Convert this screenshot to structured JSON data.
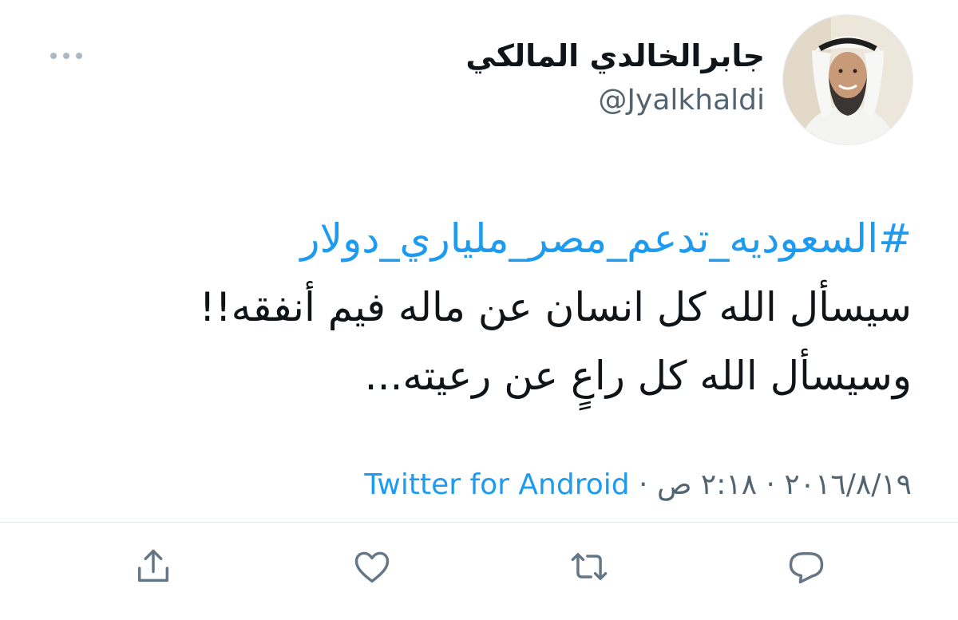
{
  "author": {
    "display_name": "جابرالخالدي المالكي",
    "handle": "@Jyalkhaldi",
    "avatar_icon": "user-avatar"
  },
  "tweet": {
    "hashtag": "#السعوديه_تدعم_مصر_ملياري_دولار",
    "lines": [
      "سيسأل الله كل انسان عن ماله فيم أنفقه!!",
      "وسيسأل الله كل راعٍ عن رعيته..."
    ]
  },
  "meta": {
    "date": "٢٠١٦/٨/١٩",
    "separator1": " · ",
    "time": "٢:١٨ ص",
    "separator2": " · ",
    "source": "Twitter for Android"
  },
  "actions": {
    "icons": [
      "share-icon",
      "like-icon",
      "retweet-icon",
      "reply-icon"
    ]
  },
  "colors": {
    "link": "#1d9bf0",
    "text": "#0f1419",
    "muted": "#536471",
    "icon": "#657786"
  }
}
